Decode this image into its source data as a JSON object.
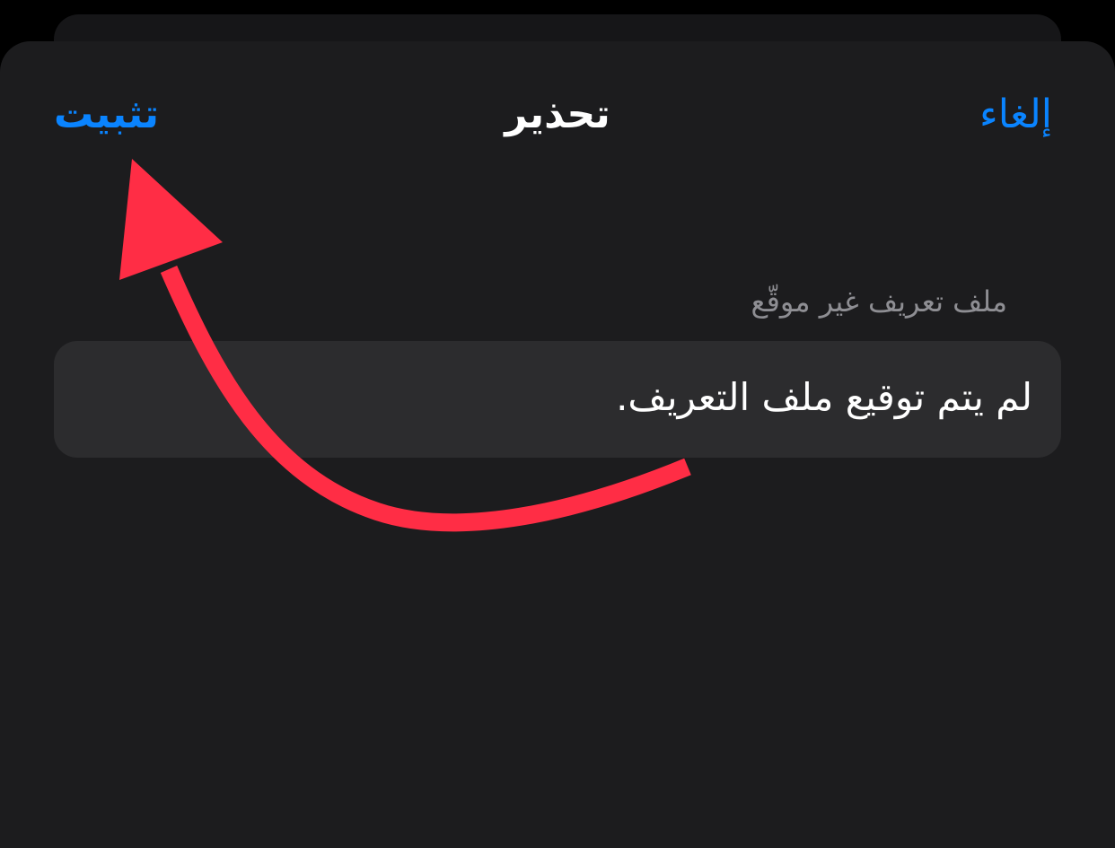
{
  "nav": {
    "install_label": "تثبيت",
    "title": "تحذير",
    "cancel_label": "إلغاء"
  },
  "section": {
    "header": "ملف تعريف غير موقّع",
    "row_text": "لم يتم توقيع ملف التعريف."
  },
  "annotation": {
    "icon": "curved-arrow-icon",
    "color": "#ff2d45"
  },
  "colors": {
    "accent": "#0a84ff",
    "sheet_background": "#1c1c1e",
    "row_background": "#2c2c2e",
    "secondary_text": "#8e8e93"
  }
}
